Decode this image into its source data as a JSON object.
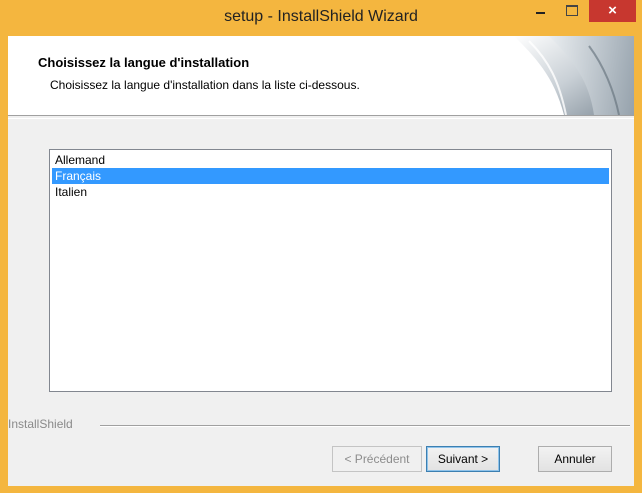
{
  "window": {
    "title": "setup - InstallShield Wizard",
    "close_glyph": "×",
    "accent_color": "#f4b63f",
    "close_color": "#c7372f"
  },
  "header": {
    "title": "Choisissez la langue d'installation",
    "subtitle": "Choisissez la langue d'installation dans la liste ci-dessous."
  },
  "languages": {
    "items": [
      "Allemand",
      "Français",
      "Italien"
    ],
    "selected": "Français",
    "selection_color": "#3399ff"
  },
  "footer": {
    "brand": "InstallShield"
  },
  "buttons": {
    "back": "< Précédent",
    "next": "Suivant >",
    "cancel": "Annuler"
  },
  "icons": {
    "minimize": "minimize-icon",
    "maximize": "maximize-icon",
    "close": "close-icon",
    "logo": "installshield-logo-graphic"
  }
}
